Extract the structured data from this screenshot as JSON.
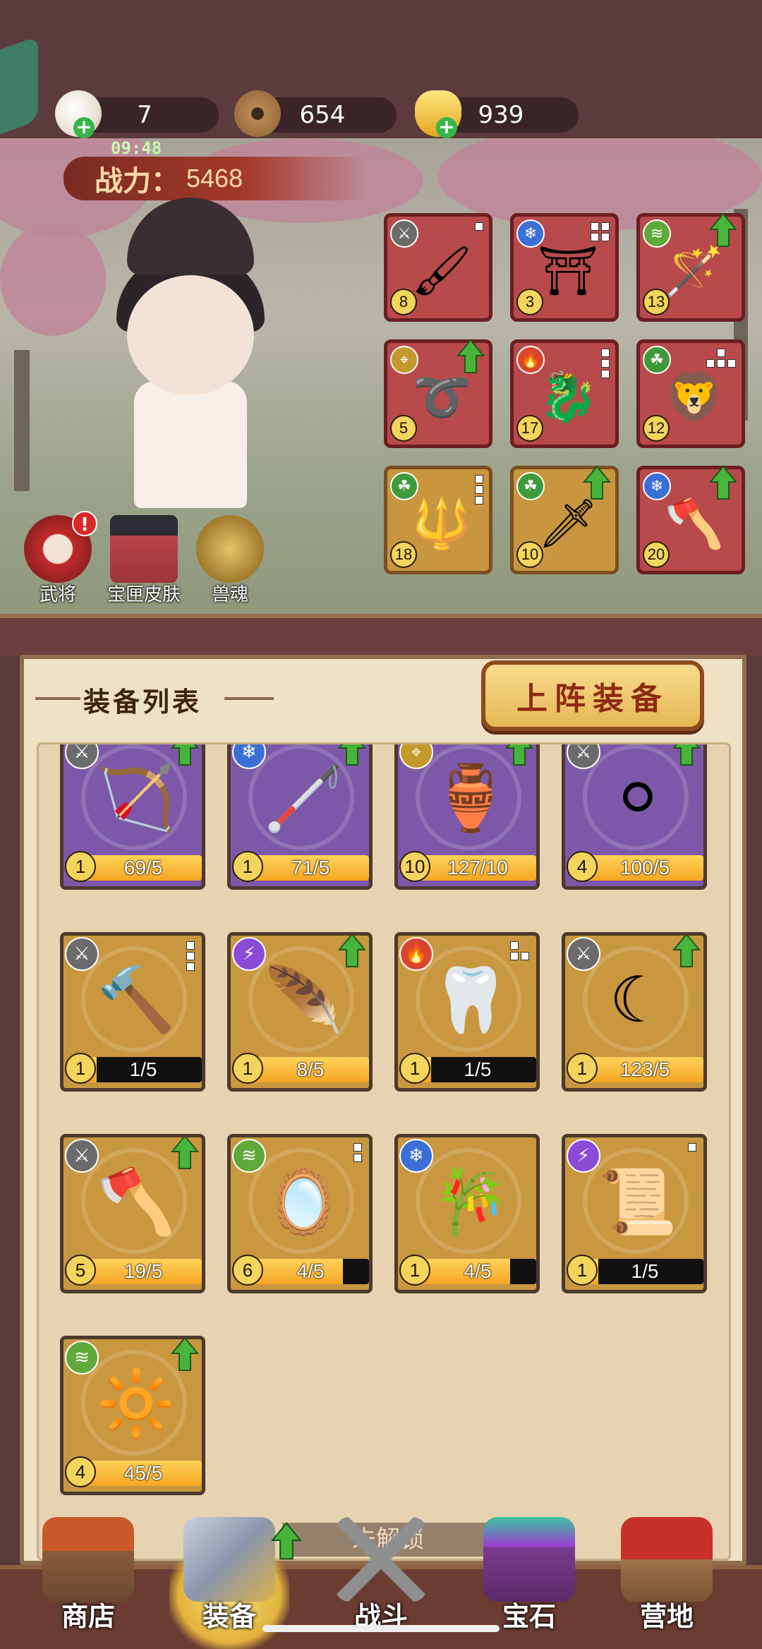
{
  "resources": {
    "peach": {
      "icon": "peach-icon",
      "value": "7"
    },
    "coin": {
      "icon": "copper-coin-icon",
      "value": "654"
    },
    "ingot": {
      "icon": "gold-ingot-icon",
      "value": "939"
    }
  },
  "status_time": "09:48",
  "power": {
    "label": "战力：",
    "value": "5468"
  },
  "side_buttons": [
    {
      "label": "武将",
      "icon": "opera-general-icon",
      "badge": "!"
    },
    {
      "label": "宝匣皮肤",
      "icon": "treasure-gate-icon"
    },
    {
      "label": "兽魂",
      "icon": "beast-soul-icon"
    }
  ],
  "equipped": [
    {
      "level": "8",
      "element": "sword",
      "item": "brush-torch"
    },
    {
      "level": "3",
      "element": "ice",
      "item": "bronze-cauldron"
    },
    {
      "level": "13",
      "element": "wind",
      "item": "jade-scepter",
      "upgrade": true
    },
    {
      "level": "5",
      "element": "target",
      "item": "leather-belt",
      "upgrade": true
    },
    {
      "level": "17",
      "element": "fire",
      "item": "jade-dragon"
    },
    {
      "level": "12",
      "element": "poison",
      "item": "lion-seal"
    },
    {
      "level": "18",
      "element": "poison",
      "item": "long-spear"
    },
    {
      "level": "10",
      "element": "poison",
      "item": "curved-blade",
      "upgrade": true
    },
    {
      "level": "20",
      "element": "ice",
      "item": "golden-axe",
      "upgrade": true
    }
  ],
  "panel": {
    "title": "装备列表",
    "deploy_button": "上阵装备"
  },
  "equipment_list": [
    {
      "level": "1",
      "progress_text": "69/5",
      "fill": 1.0,
      "element": "sword",
      "item": "bow",
      "upgrade": true
    },
    {
      "level": "1",
      "progress_text": "71/5",
      "fill": 1.0,
      "element": "ice",
      "item": "crook-staff",
      "upgrade": true
    },
    {
      "level": "10",
      "progress_text": "127/10",
      "fill": 1.0,
      "element": "target",
      "item": "gourd",
      "upgrade": true
    },
    {
      "level": "4",
      "progress_text": "100/5",
      "fill": 1.0,
      "element": "sword",
      "item": "pearl",
      "upgrade": true
    },
    {
      "level": "1",
      "progress_text": "1/5",
      "fill": 0.2,
      "element": "sword",
      "item": "stone-hammer"
    },
    {
      "level": "1",
      "progress_text": "8/5",
      "fill": 1.0,
      "element": "lightning",
      "item": "feather-brush",
      "upgrade": true
    },
    {
      "level": "1",
      "progress_text": "1/5",
      "fill": 0.2,
      "element": "fire",
      "item": "fang"
    },
    {
      "level": "1",
      "progress_text": "123/5",
      "fill": 1.0,
      "element": "sword",
      "item": "sickle",
      "upgrade": true
    },
    {
      "level": "5",
      "progress_text": "19/5",
      "fill": 1.0,
      "element": "sword",
      "item": "axe",
      "upgrade": true
    },
    {
      "level": "6",
      "progress_text": "4/5",
      "fill": 0.8,
      "element": "wind",
      "item": "hand-mirror"
    },
    {
      "level": "1",
      "progress_text": "4/5",
      "fill": 0.8,
      "element": "ice",
      "item": "flute"
    },
    {
      "level": "1",
      "progress_text": "1/5",
      "fill": 0.2,
      "element": "lightning",
      "item": "scroll"
    },
    {
      "level": "4",
      "progress_text": "45/5",
      "fill": 1.0,
      "element": "wind",
      "item": "bronze-mirror",
      "upgrade": true
    }
  ],
  "unlock_text": "未解锁",
  "nav": [
    {
      "label": "商店",
      "icon": "shop-icon"
    },
    {
      "label": "装备",
      "icon": "equipment-icon",
      "selected": true,
      "upgrade": true
    },
    {
      "label": "战斗",
      "icon": "crossed-swords-icon"
    },
    {
      "label": "宝石",
      "icon": "gem-chest-icon"
    },
    {
      "label": "营地",
      "icon": "camp-flag-icon"
    }
  ],
  "colors": {
    "red_slot": "#b84a4b",
    "gold_slot": "#c8963e",
    "purple_card": "#7d58a8",
    "progress_fill": "#f5a623",
    "upgrade_arrow": "#48b43c"
  }
}
